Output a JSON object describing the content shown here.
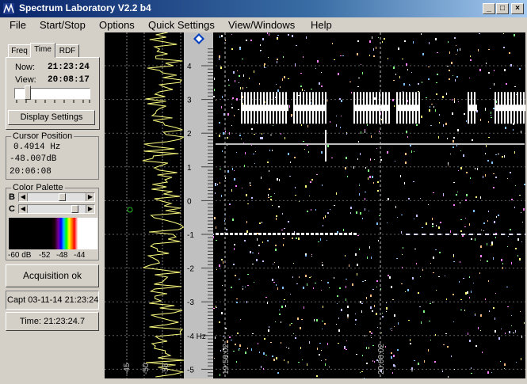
{
  "window": {
    "title": "Spectrum Laboratory V2.2 b4"
  },
  "titlebar_buttons": {
    "minimize": "_",
    "maximize": "□",
    "close": "×"
  },
  "menu": [
    {
      "label": "File"
    },
    {
      "label": "Start/Stop"
    },
    {
      "label": "Options"
    },
    {
      "label": "Quick Settings"
    },
    {
      "label": "View/Windows"
    },
    {
      "label": "Help"
    }
  ],
  "tabs": [
    {
      "label": "Freq"
    },
    {
      "label": "Time"
    },
    {
      "label": "RDF"
    }
  ],
  "time_panel": {
    "now_label": "Now:",
    "now_value": "21:23:24",
    "view_label": "View:",
    "view_value": "20:08:17",
    "slider_position": 0.15,
    "display_settings": "Display Settings"
  },
  "cursor_position": {
    "title": "Cursor Position",
    "frequency": "0.4914 Hz",
    "level": "-48.007dB",
    "time": "20:06:08"
  },
  "color_palette": {
    "title": "Color Palette",
    "b_label": "B",
    "c_label": "C",
    "b_position": 0.6,
    "c_position": 0.85,
    "scale_labels": [
      "-60 dB",
      "-52",
      "-48",
      "-44"
    ]
  },
  "status": {
    "acquisition": "Acquisition ok",
    "capture": "Capt 03-11-14 21:23:24",
    "time": "Time:  21:23:24.7"
  },
  "spectrum_axis": {
    "labels": [
      "-45",
      "-50",
      "-55"
    ]
  },
  "frequency_scale": {
    "labels": [
      "4",
      "3",
      "2",
      "1",
      "0",
      "-1",
      "-2",
      "-3",
      "-4 Hz",
      "-5"
    ],
    "values": [
      4,
      3,
      2,
      1,
      0,
      -1,
      -2,
      -3,
      -4,
      -5
    ],
    "marker": "diamond"
  },
  "time_axis": {
    "labels": [
      "19:50:02",
      "20:00:02"
    ]
  },
  "colors": {
    "trace": "#ffff80",
    "grid": "#c0c0c0",
    "titlebar": "#0a246a",
    "signal": "#ffffff"
  }
}
